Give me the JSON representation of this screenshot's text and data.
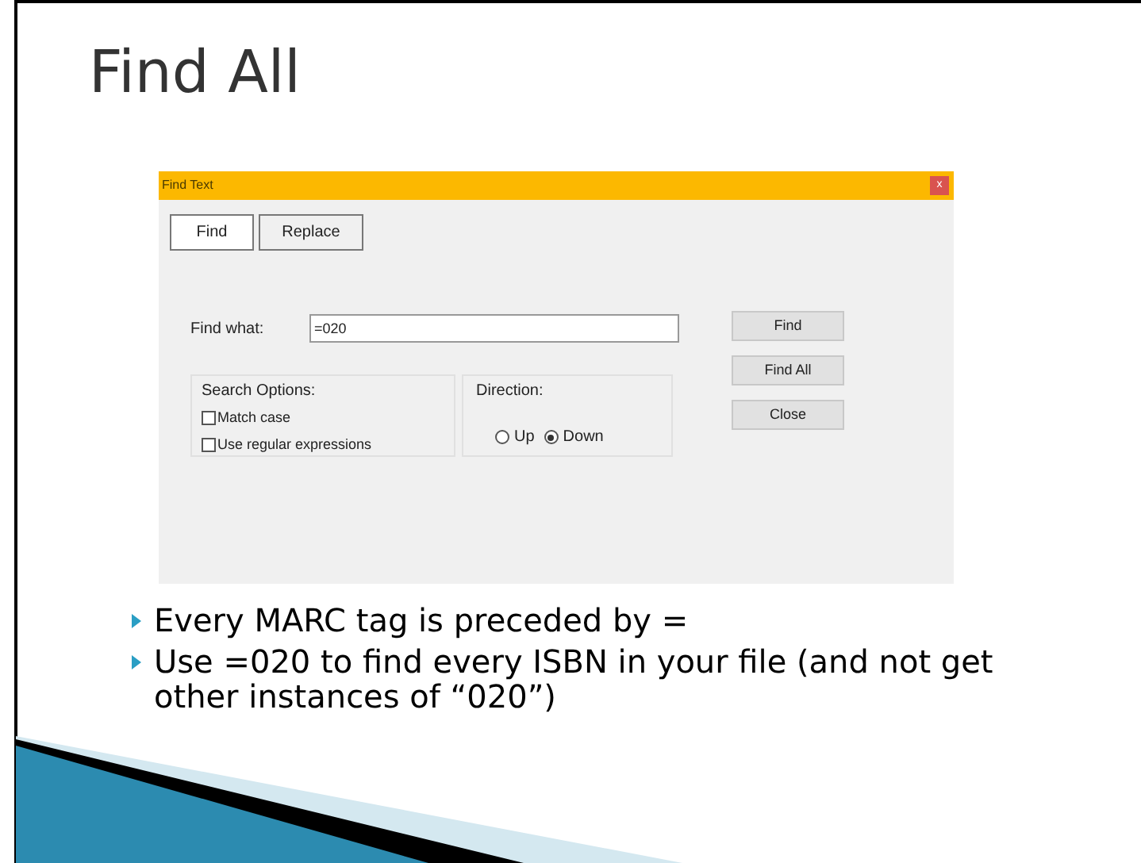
{
  "slide": {
    "title": "Find All",
    "bullets": [
      "Every MARC tag is preceded by =",
      "Use =020 to find every ISBN in your file (and not get other instances of “020”)"
    ]
  },
  "dialog": {
    "title": "Find Text",
    "close": "x",
    "tabs": [
      {
        "label": "Find",
        "selected": true
      },
      {
        "label": "Replace",
        "selected": false
      }
    ],
    "find_what": {
      "label": "Find what:",
      "value": "=020"
    },
    "search_options": {
      "title": "Search Options:",
      "options": [
        {
          "label": "Match case",
          "checked": false
        },
        {
          "label": "Use regular expressions",
          "checked": false
        }
      ]
    },
    "direction": {
      "title": "Direction:",
      "options": [
        {
          "label": "Up",
          "selected": false
        },
        {
          "label": "Down",
          "selected": true
        }
      ]
    },
    "buttons": [
      "Find",
      "Find All",
      "Close"
    ]
  }
}
